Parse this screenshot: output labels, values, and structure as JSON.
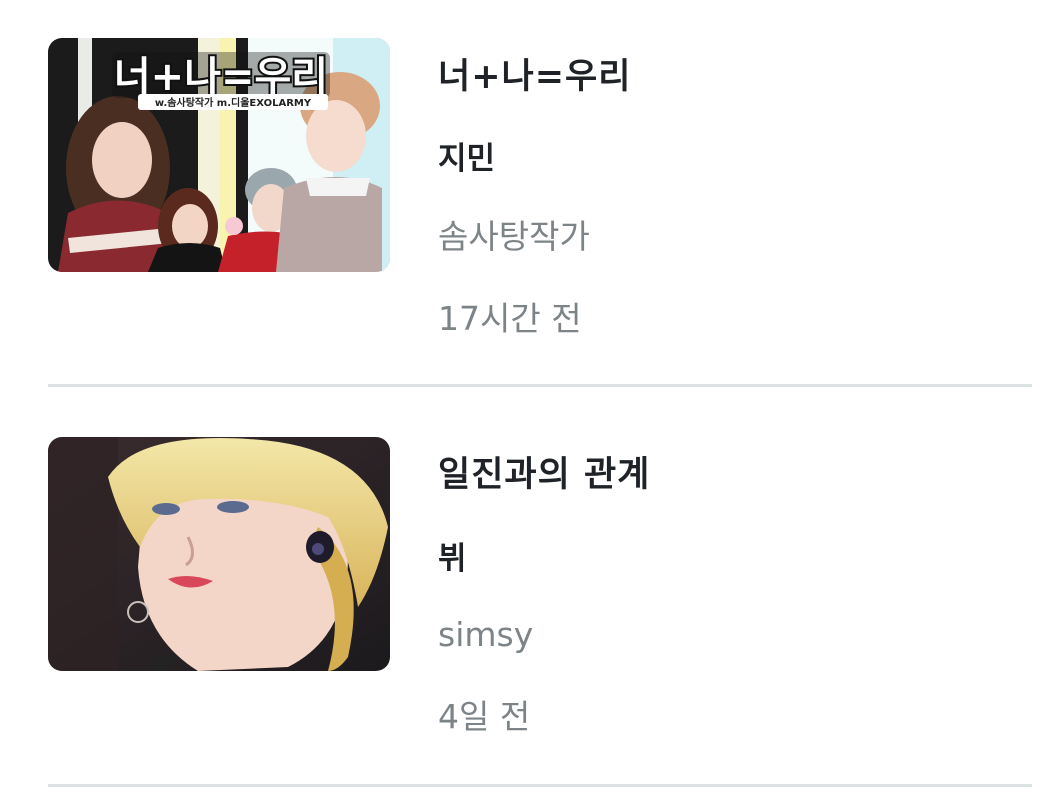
{
  "stories": [
    {
      "title": "너+나=우리",
      "character": "지민",
      "author": "솜사탕작가",
      "time": "17시간 전",
      "cover_title": "너+나=우리",
      "cover_credit": "w.솜사탕작가 m.디올EXOLARMY"
    },
    {
      "title": "일진과의 관계",
      "character": "뷔",
      "author": "simsy",
      "time": "4일 전"
    }
  ],
  "colors": {
    "title_text": "#1f2328",
    "meta_text": "#7d8488",
    "divider": "#dde3e4"
  }
}
